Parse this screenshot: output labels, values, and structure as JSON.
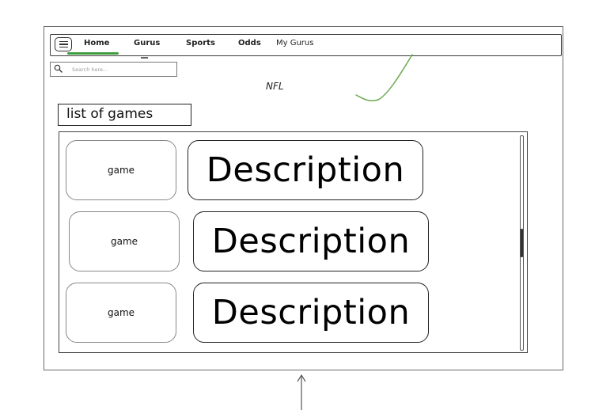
{
  "nav": {
    "items": [
      {
        "label": "Home",
        "active": true
      },
      {
        "label": "Gurus"
      },
      {
        "label": "Sports"
      },
      {
        "label": "Odds"
      },
      {
        "label": "My Gurus"
      }
    ],
    "menu_icon": "hamburger-icon",
    "active_color": "#3f9d3f"
  },
  "search": {
    "placeholder": "Search here...",
    "value": "",
    "icon": "search-icon"
  },
  "page": {
    "title": "NFL",
    "annotation_color": "#6aa84f"
  },
  "list": {
    "label": "list of games",
    "items": [
      {
        "game": "game",
        "description": "Description"
      },
      {
        "game": "game",
        "description": "Description"
      },
      {
        "game": "game",
        "description": "Description"
      }
    ]
  }
}
